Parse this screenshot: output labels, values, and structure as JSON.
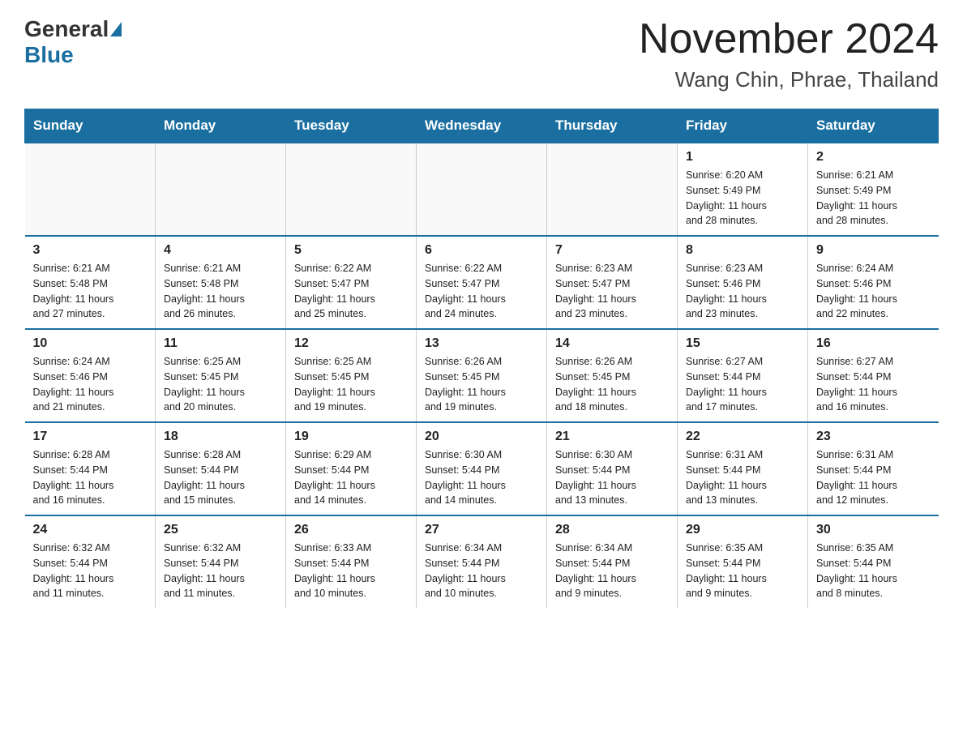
{
  "header": {
    "logo_general": "General",
    "logo_blue": "Blue",
    "title": "November 2024",
    "subtitle": "Wang Chin, Phrae, Thailand"
  },
  "weekdays": [
    "Sunday",
    "Monday",
    "Tuesday",
    "Wednesday",
    "Thursday",
    "Friday",
    "Saturday"
  ],
  "weeks": [
    [
      {
        "day": "",
        "info": ""
      },
      {
        "day": "",
        "info": ""
      },
      {
        "day": "",
        "info": ""
      },
      {
        "day": "",
        "info": ""
      },
      {
        "day": "",
        "info": ""
      },
      {
        "day": "1",
        "info": "Sunrise: 6:20 AM\nSunset: 5:49 PM\nDaylight: 11 hours\nand 28 minutes."
      },
      {
        "day": "2",
        "info": "Sunrise: 6:21 AM\nSunset: 5:49 PM\nDaylight: 11 hours\nand 28 minutes."
      }
    ],
    [
      {
        "day": "3",
        "info": "Sunrise: 6:21 AM\nSunset: 5:48 PM\nDaylight: 11 hours\nand 27 minutes."
      },
      {
        "day": "4",
        "info": "Sunrise: 6:21 AM\nSunset: 5:48 PM\nDaylight: 11 hours\nand 26 minutes."
      },
      {
        "day": "5",
        "info": "Sunrise: 6:22 AM\nSunset: 5:47 PM\nDaylight: 11 hours\nand 25 minutes."
      },
      {
        "day": "6",
        "info": "Sunrise: 6:22 AM\nSunset: 5:47 PM\nDaylight: 11 hours\nand 24 minutes."
      },
      {
        "day": "7",
        "info": "Sunrise: 6:23 AM\nSunset: 5:47 PM\nDaylight: 11 hours\nand 23 minutes."
      },
      {
        "day": "8",
        "info": "Sunrise: 6:23 AM\nSunset: 5:46 PM\nDaylight: 11 hours\nand 23 minutes."
      },
      {
        "day": "9",
        "info": "Sunrise: 6:24 AM\nSunset: 5:46 PM\nDaylight: 11 hours\nand 22 minutes."
      }
    ],
    [
      {
        "day": "10",
        "info": "Sunrise: 6:24 AM\nSunset: 5:46 PM\nDaylight: 11 hours\nand 21 minutes."
      },
      {
        "day": "11",
        "info": "Sunrise: 6:25 AM\nSunset: 5:45 PM\nDaylight: 11 hours\nand 20 minutes."
      },
      {
        "day": "12",
        "info": "Sunrise: 6:25 AM\nSunset: 5:45 PM\nDaylight: 11 hours\nand 19 minutes."
      },
      {
        "day": "13",
        "info": "Sunrise: 6:26 AM\nSunset: 5:45 PM\nDaylight: 11 hours\nand 19 minutes."
      },
      {
        "day": "14",
        "info": "Sunrise: 6:26 AM\nSunset: 5:45 PM\nDaylight: 11 hours\nand 18 minutes."
      },
      {
        "day": "15",
        "info": "Sunrise: 6:27 AM\nSunset: 5:44 PM\nDaylight: 11 hours\nand 17 minutes."
      },
      {
        "day": "16",
        "info": "Sunrise: 6:27 AM\nSunset: 5:44 PM\nDaylight: 11 hours\nand 16 minutes."
      }
    ],
    [
      {
        "day": "17",
        "info": "Sunrise: 6:28 AM\nSunset: 5:44 PM\nDaylight: 11 hours\nand 16 minutes."
      },
      {
        "day": "18",
        "info": "Sunrise: 6:28 AM\nSunset: 5:44 PM\nDaylight: 11 hours\nand 15 minutes."
      },
      {
        "day": "19",
        "info": "Sunrise: 6:29 AM\nSunset: 5:44 PM\nDaylight: 11 hours\nand 14 minutes."
      },
      {
        "day": "20",
        "info": "Sunrise: 6:30 AM\nSunset: 5:44 PM\nDaylight: 11 hours\nand 14 minutes."
      },
      {
        "day": "21",
        "info": "Sunrise: 6:30 AM\nSunset: 5:44 PM\nDaylight: 11 hours\nand 13 minutes."
      },
      {
        "day": "22",
        "info": "Sunrise: 6:31 AM\nSunset: 5:44 PM\nDaylight: 11 hours\nand 13 minutes."
      },
      {
        "day": "23",
        "info": "Sunrise: 6:31 AM\nSunset: 5:44 PM\nDaylight: 11 hours\nand 12 minutes."
      }
    ],
    [
      {
        "day": "24",
        "info": "Sunrise: 6:32 AM\nSunset: 5:44 PM\nDaylight: 11 hours\nand 11 minutes."
      },
      {
        "day": "25",
        "info": "Sunrise: 6:32 AM\nSunset: 5:44 PM\nDaylight: 11 hours\nand 11 minutes."
      },
      {
        "day": "26",
        "info": "Sunrise: 6:33 AM\nSunset: 5:44 PM\nDaylight: 11 hours\nand 10 minutes."
      },
      {
        "day": "27",
        "info": "Sunrise: 6:34 AM\nSunset: 5:44 PM\nDaylight: 11 hours\nand 10 minutes."
      },
      {
        "day": "28",
        "info": "Sunrise: 6:34 AM\nSunset: 5:44 PM\nDaylight: 11 hours\nand 9 minutes."
      },
      {
        "day": "29",
        "info": "Sunrise: 6:35 AM\nSunset: 5:44 PM\nDaylight: 11 hours\nand 9 minutes."
      },
      {
        "day": "30",
        "info": "Sunrise: 6:35 AM\nSunset: 5:44 PM\nDaylight: 11 hours\nand 8 minutes."
      }
    ]
  ]
}
